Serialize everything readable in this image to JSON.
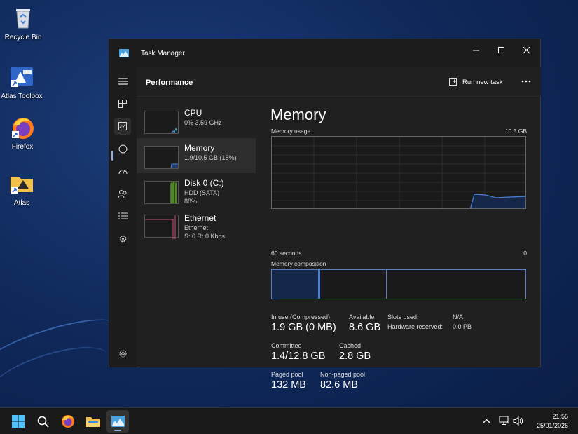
{
  "desktop": {
    "icons": [
      {
        "label": "Recycle Bin"
      },
      {
        "label": "Atlas Toolbox"
      },
      {
        "label": "Firefox"
      },
      {
        "label": "Atlas"
      }
    ]
  },
  "window": {
    "title": "Task Manager",
    "header": {
      "title": "Performance",
      "run_new_task": "Run new task"
    },
    "sidebar": {
      "items": [
        {
          "icon": "hamburger-icon"
        },
        {
          "icon": "processes-icon"
        },
        {
          "icon": "performance-icon"
        },
        {
          "icon": "app-history-icon"
        },
        {
          "icon": "startup-apps-icon"
        },
        {
          "icon": "users-icon"
        },
        {
          "icon": "details-icon"
        },
        {
          "icon": "services-icon"
        },
        {
          "icon": "settings-icon"
        }
      ]
    },
    "perf_list": [
      {
        "name": "CPU",
        "line1": "0% 3.59 GHz",
        "line2": "",
        "color": "#4a9fd6"
      },
      {
        "name": "Memory",
        "line1": "1.9/10.5 GB (18%)",
        "line2": "",
        "color": "#4a7fd6"
      },
      {
        "name": "Disk 0 (C:)",
        "line1": "HDD (SATA)",
        "line2": "88%",
        "color": "#7ac13c"
      },
      {
        "name": "Ethernet",
        "line1": "Ethernet",
        "line2": "S: 0 R: 0 Kbps",
        "color": "#d6477a"
      }
    ],
    "memory": {
      "title": "Memory",
      "usage_label": "Memory usage",
      "max_label": "10.5 GB",
      "x_start": "60 seconds",
      "x_end": "0",
      "composition_label": "Memory composition",
      "stats": {
        "in_use_label": "In use (Compressed)",
        "in_use_value": "1.9 GB (0 MB)",
        "available_label": "Available",
        "available_value": "8.6 GB",
        "committed_label": "Committed",
        "committed_value": "1.4/12.8 GB",
        "cached_label": "Cached",
        "cached_value": "2.8 GB",
        "paged_pool_label": "Paged pool",
        "paged_pool_value": "132 MB",
        "nonpaged_pool_label": "Non-paged pool",
        "nonpaged_pool_value": "82.6 MB",
        "slots_used_label": "Slots used:",
        "slots_used_value": "N/A",
        "hw_reserved_label": "Hardware reserved:",
        "hw_reserved_value": "0.0 PB"
      }
    }
  },
  "taskbar": {
    "time": "21:55",
    "date": "25/01/2026"
  },
  "colors": {
    "memory_accent": "#4a7fd6",
    "window_bg": "#202020"
  }
}
